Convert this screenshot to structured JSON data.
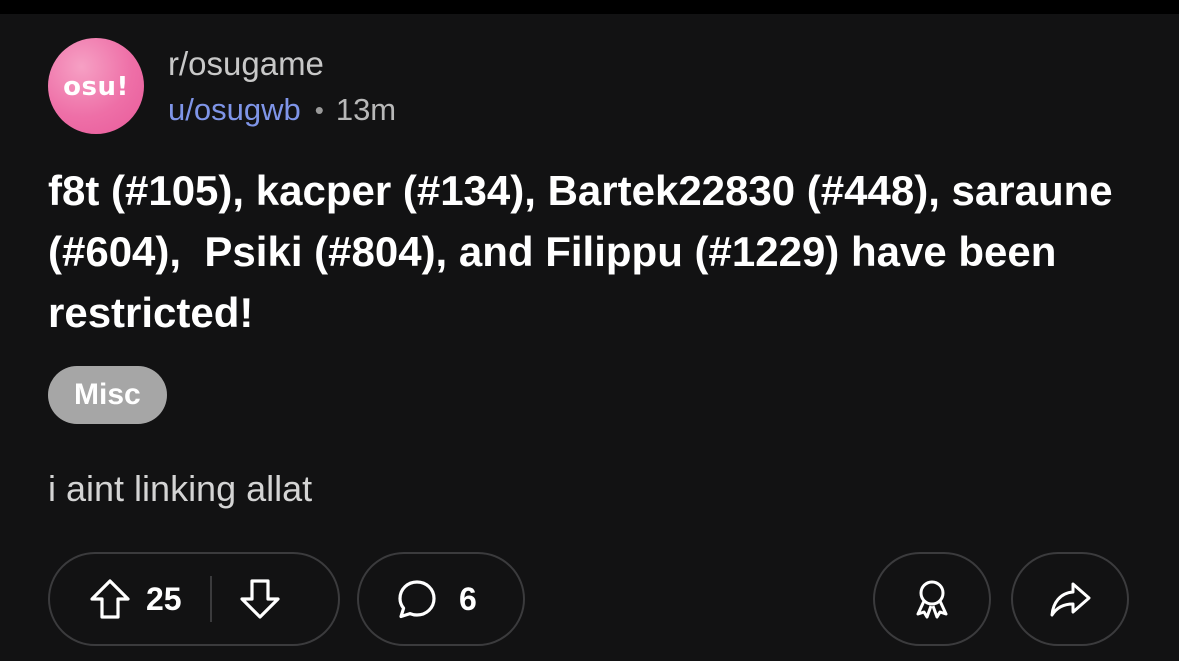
{
  "post": {
    "subreddit": "r/osugame",
    "username": "u/osugwb",
    "separator": "•",
    "time": "13m",
    "avatar_text": "osu!",
    "title": "f8t (#105), kacper (#134), Bartek22830 (#448), saraune (#604),  Psiki (#804), and Filippu (#1229) have been restricted!",
    "flair": "Misc",
    "body": "i aint linking allat"
  },
  "actions": {
    "upvote_icon": "arrow-up-icon",
    "downvote_icon": "arrow-down-icon",
    "score": "25",
    "comment_icon": "speech-bubble-icon",
    "comments": "6",
    "award_icon": "award-ribbon-icon",
    "share_icon": "share-arrow-icon"
  },
  "colors": {
    "background": "#121213",
    "username": "#7f95e8",
    "flair_bg": "#a6a6a6",
    "avatar_pink": "#ee6fa7",
    "pill_border": "#3b3b3d"
  }
}
